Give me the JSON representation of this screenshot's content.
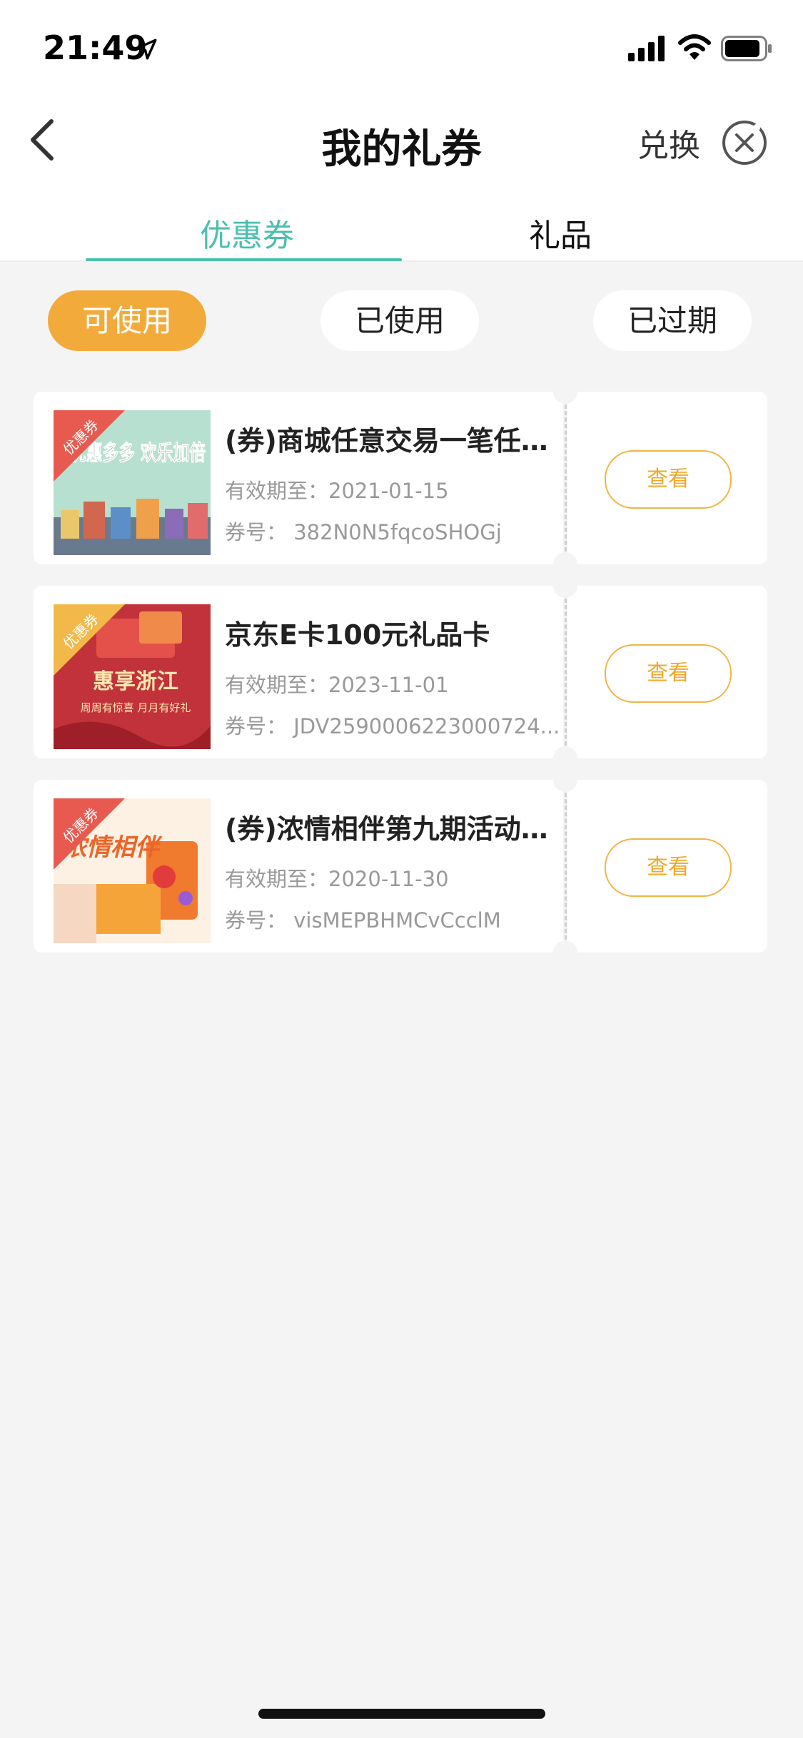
{
  "status_bar": {
    "time": "21:49"
  },
  "header": {
    "title": "我的礼券",
    "exchange_label": "兑换"
  },
  "tabs": [
    {
      "label": "优惠券",
      "active": true
    },
    {
      "label": "礼品",
      "active": false
    }
  ],
  "filters": [
    {
      "label": "可使用",
      "active": true
    },
    {
      "label": "已使用",
      "active": false
    },
    {
      "label": "已过期",
      "active": false
    }
  ],
  "coupons": [
    {
      "badge": "优惠券",
      "image_text": "优惠多多 欢乐加倍",
      "title": "(券)商城任意交易一笔任意金额",
      "expiry_label": "有效期至：",
      "expiry": "2021-01-15",
      "code_label": "券号：",
      "code": "382N0N5fqcoSHOGj",
      "action": "查看"
    },
    {
      "badge": "优惠券",
      "image_text": "惠享浙江",
      "image_subtext": "周周有惊喜  月月有好礼",
      "title": "京东E卡100元礼品卡",
      "expiry_label": "有效期至：",
      "expiry": "2023-11-01",
      "code_label": "券号：",
      "code": "JDV2590006223000724...",
      "action": "查看"
    },
    {
      "badge": "优惠券",
      "image_text": "浓情相伴",
      "title": "(券)浓情相伴第九期活动奖励",
      "expiry_label": "有效期至：",
      "expiry": "2020-11-30",
      "code_label": "券号：",
      "code": "visMEPBHMCvCcclM",
      "action": "查看"
    }
  ],
  "colors": {
    "accent_teal": "#4cbfae",
    "accent_orange": "#f2ab3a",
    "background": "#f4f4f4"
  }
}
